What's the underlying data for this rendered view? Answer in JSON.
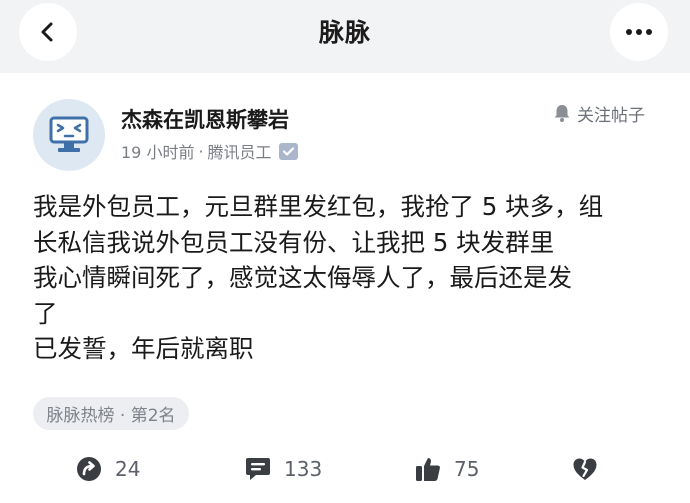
{
  "navbar": {
    "title": "脉脉",
    "back_icon": "chevron-left-icon",
    "more_icon": "more-horizontal-icon"
  },
  "post": {
    "author": "杰森在凯恩斯攀岩",
    "time": "19 小时前",
    "separator": "·",
    "company": "腾讯员工",
    "follow_label": "关注帖子",
    "content_lines": [
      "我是外包员工，元旦群里发红包，我抢了 5 块多，组",
      "长私信我说外包员工没有份、让我把 5 块发群里",
      "我心情瞬间死了，感觉这太侮辱人了，最后还是发",
      "了",
      "已发誓，年后就离职"
    ],
    "hot_tag": "脉脉热榜 · 第2名"
  },
  "actions": {
    "share_count": "24",
    "comment_count": "133",
    "like_count": "75"
  },
  "colors": {
    "navbar_bg": "#f2f3f5",
    "avatar_bg": "#dde8f3",
    "avatar_accent": "#3f70a8",
    "meta_text": "#7a7e85",
    "icon_dark": "#3a3d42"
  }
}
